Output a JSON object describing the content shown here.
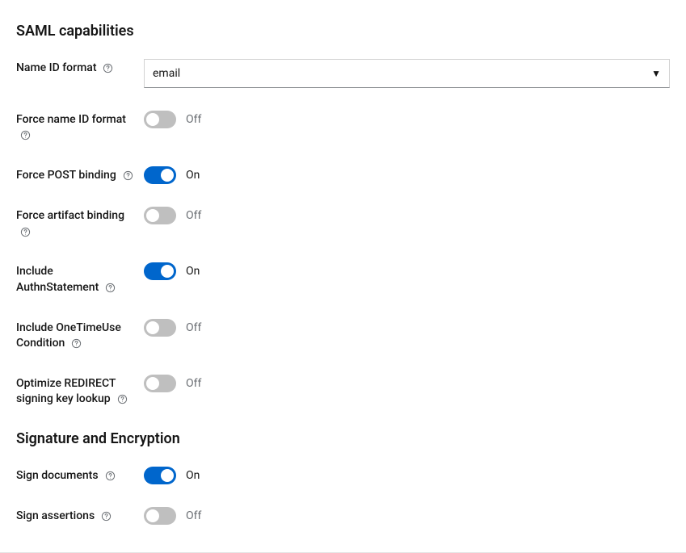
{
  "sections": {
    "saml": {
      "title": "SAML capabilities"
    },
    "sig": {
      "title": "Signature and Encryption"
    }
  },
  "stateLabels": {
    "on": "On",
    "off": "Off"
  },
  "fields": {
    "nameIdFormat": {
      "label": "Name ID format",
      "value": "email"
    },
    "forceNameId": {
      "label": "Force name ID format",
      "on": false
    },
    "forcePost": {
      "label": "Force POST binding",
      "on": true
    },
    "forceArtifact": {
      "label": "Force artifact binding",
      "on": false
    },
    "includeAuthn": {
      "label": "Include AuthnStatement",
      "on": true
    },
    "includeOneTime": {
      "label": "Include OneTimeUse Condition",
      "on": false
    },
    "optimizeRedir": {
      "label": "Optimize REDIRECT signing key lookup",
      "on": false
    },
    "signDocs": {
      "label": "Sign documents",
      "on": true
    },
    "signAssert": {
      "label": "Sign assertions",
      "on": false
    }
  }
}
